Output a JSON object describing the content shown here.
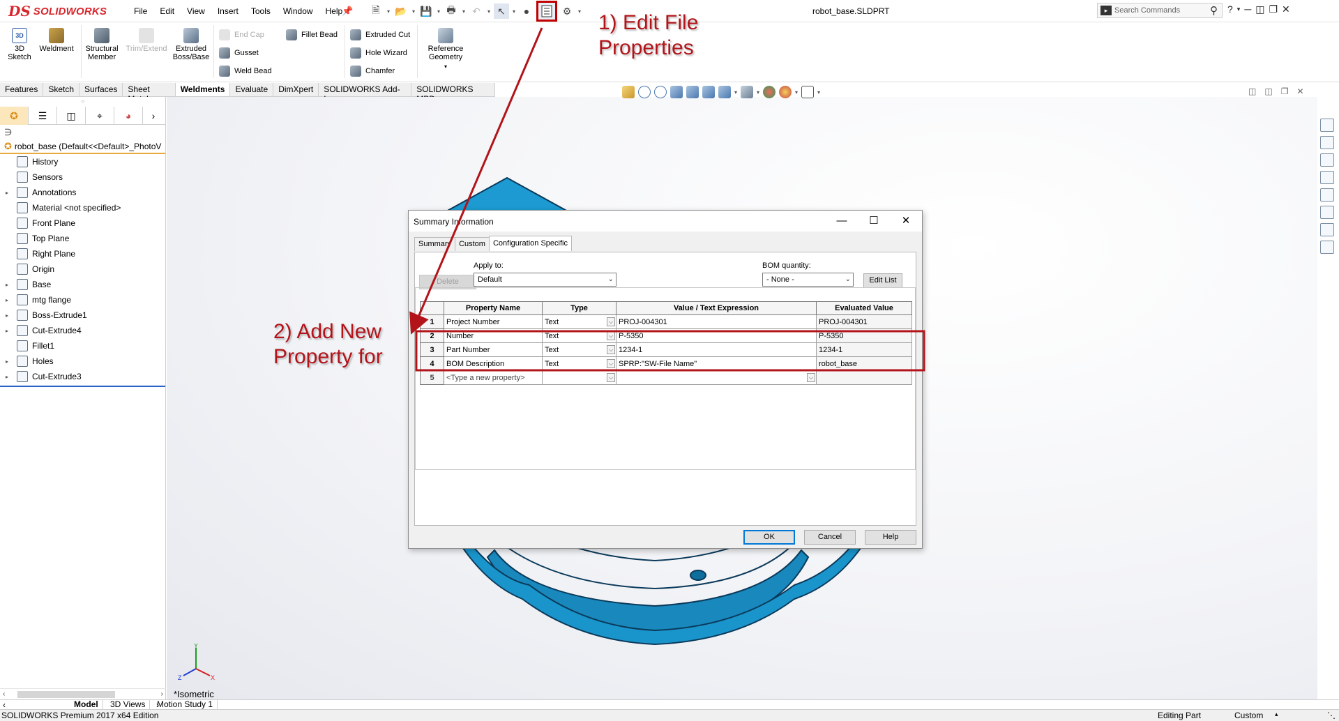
{
  "app": {
    "logo_ds": "DS",
    "logo_name": "SOLIDWORKS",
    "doc_title": "robot_base.SLDPRT",
    "search_placeholder": "Search Commands",
    "help_glyph": "?"
  },
  "menu": [
    "File",
    "Edit",
    "View",
    "Insert",
    "Tools",
    "Window",
    "Help"
  ],
  "ribbon": {
    "large_buttons": [
      {
        "label": "3D\nSketch",
        "name": "3d-sketch-button",
        "disabled": false
      },
      {
        "label": "Weldment",
        "name": "weldment-button",
        "disabled": false
      },
      {
        "label": "Structural\nMember",
        "name": "structural-member-button",
        "disabled": false
      },
      {
        "label": "Trim/Extend",
        "name": "trim-extend-button",
        "disabled": true
      },
      {
        "label": "Extruded\nBoss/Base",
        "name": "extruded-boss-button",
        "disabled": false
      },
      {
        "label": "Reference\nGeometry",
        "name": "reference-geometry-button",
        "disabled": false
      }
    ],
    "small_buttons": [
      {
        "label": "End Cap",
        "disabled": true
      },
      {
        "label": "Gusset",
        "disabled": false
      },
      {
        "label": "Weld Bead",
        "disabled": false
      },
      {
        "label": "Fillet Bead",
        "disabled": false
      },
      {
        "label": "Extruded Cut",
        "disabled": false
      },
      {
        "label": "Hole Wizard",
        "disabled": false
      },
      {
        "label": "Chamfer",
        "disabled": false
      }
    ]
  },
  "tabs": [
    "Features",
    "Sketch",
    "Surfaces",
    "Sheet Metal",
    "Weldments",
    "Evaluate",
    "DimXpert",
    "SOLIDWORKS Add-Ins",
    "SOLIDWORKS MBD"
  ],
  "active_tab": "Weldments",
  "tree": {
    "root": "robot_base  (Default<<Default>_PhotoV",
    "items": [
      {
        "label": "History",
        "expandable": false
      },
      {
        "label": "Sensors",
        "expandable": false
      },
      {
        "label": "Annotations",
        "expandable": true
      },
      {
        "label": "Material <not specified>",
        "expandable": false
      },
      {
        "label": "Front Plane",
        "expandable": false
      },
      {
        "label": "Top Plane",
        "expandable": false
      },
      {
        "label": "Right Plane",
        "expandable": false
      },
      {
        "label": "Origin",
        "expandable": false
      },
      {
        "label": "Base",
        "expandable": true
      },
      {
        "label": "mtg flange",
        "expandable": true
      },
      {
        "label": "Boss-Extrude1",
        "expandable": true
      },
      {
        "label": "Cut-Extrude4",
        "expandable": true
      },
      {
        "label": "Fillet1",
        "expandable": false
      },
      {
        "label": "Holes",
        "expandable": true
      },
      {
        "label": "Cut-Extrude3",
        "expandable": true
      }
    ]
  },
  "viewport": {
    "view_name": "*Isometric",
    "triad_labels": {
      "x": "X",
      "y": "Y",
      "z": "Z"
    }
  },
  "bottom_tabs": [
    "Model",
    "3D Views",
    "Motion Study 1"
  ],
  "status": {
    "edition": "SOLIDWORKS Premium 2017 x64 Edition",
    "mode": "Editing Part",
    "units": "Custom"
  },
  "dialog": {
    "title": "Summary Information",
    "tabs": [
      "Summary",
      "Custom",
      "Configuration Specific"
    ],
    "active_tab": "Configuration Specific",
    "delete_label": "Delete",
    "apply_to_label": "Apply to:",
    "apply_to_value": "Default",
    "bom_quantity_label": "BOM quantity:",
    "bom_quantity_value": "- None -",
    "edit_list_label": "Edit List",
    "columns": [
      "",
      "Property Name",
      "Type",
      "Value / Text Expression",
      "Evaluated Value"
    ],
    "rows": [
      {
        "num": "1",
        "name": "Project Number",
        "type": "Text",
        "value": "PROJ-004301",
        "evaluated": "PROJ-004301"
      },
      {
        "num": "2",
        "name": "Number",
        "type": "Text",
        "value": "P-5350",
        "evaluated": "P-5350"
      },
      {
        "num": "3",
        "name": "Part Number",
        "type": "Text",
        "value": "1234-1",
        "evaluated": "1234-1"
      },
      {
        "num": "4",
        "name": "BOM Description",
        "type": "Text",
        "value": "SPRP:\"SW-File Name\"",
        "evaluated": "robot_base"
      },
      {
        "num": "5",
        "name": "<Type a new property>",
        "type": "",
        "value": "",
        "evaluated": ""
      }
    ],
    "ok_label": "OK",
    "cancel_label": "Cancel",
    "help_label": "Help"
  },
  "annotations": {
    "step1_line1": "1) Edit File",
    "step1_line2": "Properties",
    "step2_line1": "2) Add New",
    "step2_line2": "Property for",
    "color": "#b2141a"
  },
  "colors": {
    "brand": "#d8262d",
    "part_blue": "#1fa0d6",
    "part_edge": "#0b3a5a",
    "highlight_box": "#c00000"
  }
}
